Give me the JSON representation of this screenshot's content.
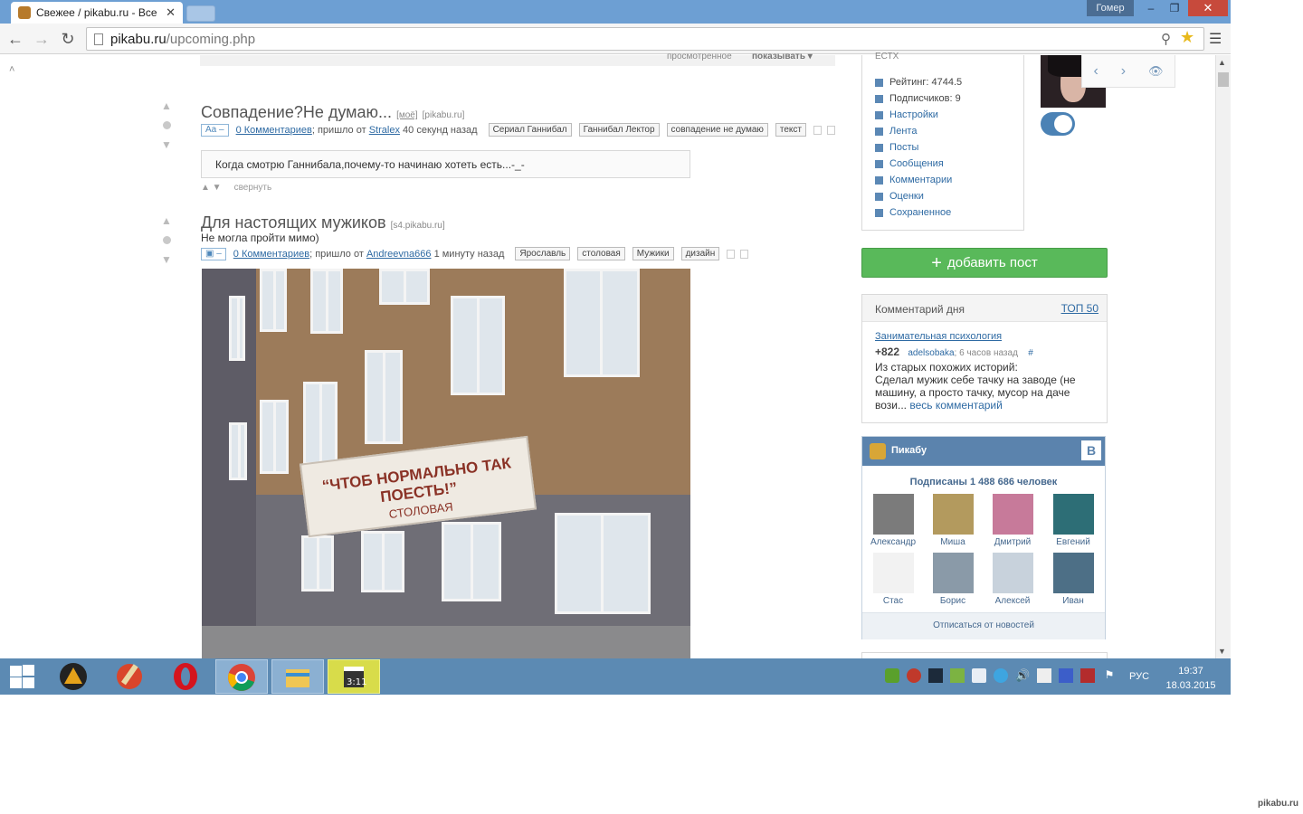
{
  "browser": {
    "tab_title": "Свежее / pikabu.ru - Все",
    "tab_close": "✕",
    "user_badge": "Гомер",
    "url_host": "pikabu.ru",
    "url_path": "/upcoming.php"
  },
  "page": {
    "topstrip_viewed": "просмотренное",
    "topstrip_show": "показывать ▾",
    "post1": {
      "title": "Совпадение?Не думаю...",
      "mine": "[моё]",
      "source": "[pikabu.ru]",
      "type_badge": "Aa –",
      "comments": "0 Комментариев",
      "from_text": "; пришло от",
      "author": "Stralex",
      "time": "40 секунд назад",
      "tags": [
        "Сериал Ганнибал",
        "Ганнибал Лектор",
        "совпадение не думаю",
        "текст"
      ],
      "quote": "Когда смотрю Ганнибала,почему-то начинаю хотеть есть...-_-",
      "collapse": "свернуть"
    },
    "post2": {
      "title": "Для настоящих мужиков",
      "source": "[s4.pikabu.ru]",
      "subtitle": "Не могла пройти мимо)",
      "type_badge": "▣ –",
      "comments": "0 Комментариев",
      "from_text": "; пришло от",
      "author": "Andreevna666",
      "time": "1 минуту назад",
      "tags": [
        "Ярославль",
        "столовая",
        "Мужики",
        "дизайн"
      ],
      "sign_line1": "“ЧТОБ НОРМАЛЬНО ТАК ПОЕСТЬ!”",
      "sign_line2": "СТОЛОВАЯ"
    }
  },
  "sidebar": {
    "user_stats": "ЕСТХ",
    "menu": [
      "Рейтинг: 4744.5",
      "Подписчиков: 9",
      "Настройки",
      "Лента",
      "Посты",
      "Сообщения",
      "Комментарии",
      "Оценки",
      "Сохраненное"
    ],
    "add_post": "добавить пост",
    "comment_of_day": {
      "header": "Комментарий дня",
      "top_link": "ТОП 50",
      "story": "Занимательная психология",
      "score": "+822",
      "author": "adelsobaka",
      "time": "; 6 часов назад",
      "hash": "#",
      "text": "Из старых похожих историй:\nСделал мужик себе тачку на заводе (не машину, а просто тачку, мусор на даче вози...",
      "more": "весь комментарий"
    },
    "vk": {
      "name": "Пикабу",
      "badge": "В",
      "subscribers": "Подписаны 1 488 686 человек",
      "users": [
        "Александр",
        "Миша",
        "Дмитрий",
        "Евгений",
        "Стас",
        "Борис",
        "Алексей",
        "Иван"
      ],
      "unsubscribe": "Отписаться от новостей"
    }
  },
  "taskbar": {
    "lang": "РУС",
    "time": "19:37",
    "date": "18.03.2015"
  },
  "watermark": "pikabu.ru",
  "colors": {
    "titlebar": "#6d9fd3",
    "taskbar": "#5c8ab3",
    "link": "#2e6aa3",
    "add_post": "#59b95a",
    "vk_header": "#5b83ad"
  }
}
